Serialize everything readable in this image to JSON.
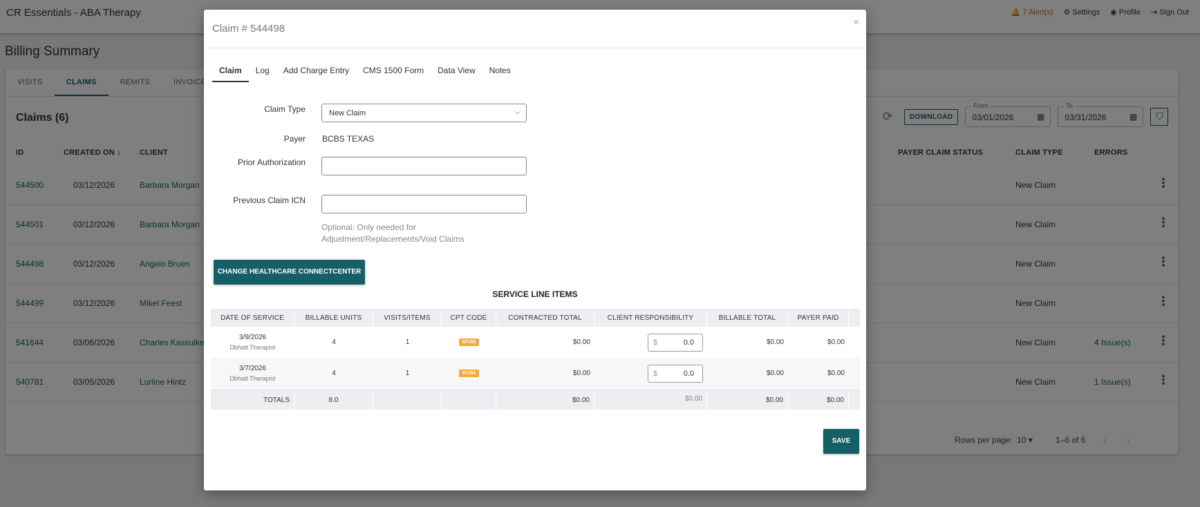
{
  "app": {
    "title": "CR Essentials - ABA Therapy",
    "alerts_label": "7 Alert(s)",
    "settings_label": "Settings",
    "profile_label": "Profile",
    "signout_label": "Sign Out"
  },
  "page": {
    "title": "Billing Summary",
    "tabs": [
      {
        "label": "VISITS",
        "active": false
      },
      {
        "label": "CLAIMS",
        "active": true
      },
      {
        "label": "REMITS",
        "active": false
      },
      {
        "label": "INVOICES",
        "active": false
      }
    ]
  },
  "claims": {
    "title": "Claims (6)",
    "download_label": "DOWNLOAD",
    "from_label": "From",
    "from_value": "03/01/2026",
    "to_label": "To",
    "to_value": "03/31/2026",
    "columns": {
      "id": "ID",
      "created_on": "CREATED ON",
      "client": "CLIENT",
      "payer_claim_status": "PAYER CLAIM STATUS",
      "claim_type": "CLAIM TYPE",
      "errors": "ERRORS"
    },
    "rows": [
      {
        "id": "544500",
        "created_on": "03/12/2026",
        "client": "Barbara Morgan",
        "claim_type": "New Claim",
        "errors": ""
      },
      {
        "id": "544501",
        "created_on": "03/12/2026",
        "client": "Barbara Morgan",
        "claim_type": "New Claim",
        "errors": ""
      },
      {
        "id": "544498",
        "created_on": "03/12/2026",
        "client": "Angelo Bruen",
        "claim_type": "New Claim",
        "errors": ""
      },
      {
        "id": "544499",
        "created_on": "03/12/2026",
        "client": "Mikel Feest",
        "claim_type": "New Claim",
        "errors": ""
      },
      {
        "id": "541644",
        "created_on": "03/06/2026",
        "client": "Charles Kassulke",
        "claim_type": "New Claim",
        "errors": "4 Issue(s)"
      },
      {
        "id": "540781",
        "created_on": "03/05/2026",
        "client": "Lurline Hintz",
        "claim_type": "New Claim",
        "errors": "1 Issue(s)"
      }
    ],
    "pager": {
      "rows_per_page_label": "Rows per page:",
      "rows_per_page_value": "10",
      "range": "1–6 of 6"
    }
  },
  "modal": {
    "title": "Claim # 544498",
    "tabs": [
      {
        "label": "Claim",
        "active": true
      },
      {
        "label": "Log",
        "active": false
      },
      {
        "label": "Add Charge Entry",
        "active": false
      },
      {
        "label": "CMS 1500 Form",
        "active": false
      },
      {
        "label": "Data View",
        "active": false
      },
      {
        "label": "Notes",
        "active": false
      }
    ],
    "form": {
      "claim_type_label": "Claim Type",
      "claim_type_value": "New Claim",
      "payer_label": "Payer",
      "payer_value": "BCBS TEXAS",
      "prior_auth_label": "Prior Authorization",
      "prior_auth_value": "",
      "prev_icn_label": "Previous Claim ICN",
      "prev_icn_value": "",
      "hint_line1": "Optional: Only needed for",
      "hint_line2": "Adjustment/Replacements/Void Claims"
    },
    "change_healthcare_label": "CHANGE HEALTHCARE CONNECTCENTER",
    "service_lines": {
      "title": "SERVICE LINE ITEMS",
      "headers": {
        "date_of_service": "DATE OF SERVICE",
        "billable_units": "BILLABLE UNITS",
        "visits_items": "VISITS/ITEMS",
        "cpt_code": "CPT CODE",
        "contracted_total": "CONTRACTED TOTAL",
        "client_responsibility": "CLIENT RESPONSIBILITY",
        "billable_total": "BILLABLE TOTAL",
        "payer_paid": "PAYER PAID"
      },
      "rows": [
        {
          "date": "3/9/2026",
          "therapist": "Dbhatt Therapist",
          "units": "4",
          "visits": "1",
          "cpt": "97153",
          "contracted": "$0.00",
          "currency": "$",
          "client_resp": "0.0",
          "billable": "$0.00",
          "paid": "$0.00"
        },
        {
          "date": "3/7/2026",
          "therapist": "Dbhatt Therapist",
          "units": "4",
          "visits": "1",
          "cpt": "97153",
          "contracted": "$0.00",
          "currency": "$",
          "client_resp": "0.0",
          "billable": "$0.00",
          "paid": "$0.00"
        }
      ],
      "totals": {
        "label": "TOTALS",
        "units": "8.0",
        "contracted": "$0.00",
        "client_resp": "$0.00",
        "billable": "$0.00",
        "paid": "$0.00"
      }
    },
    "save_label": "SAVE"
  },
  "colors": {
    "accent": "#155f66",
    "alert": "#e0621a",
    "cpt_badge": "#f0a93a"
  }
}
